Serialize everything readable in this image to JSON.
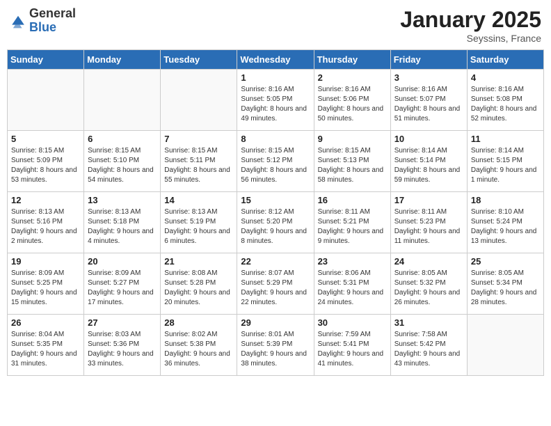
{
  "header": {
    "logo_general": "General",
    "logo_blue": "Blue",
    "month": "January 2025",
    "location": "Seyssins, France"
  },
  "days_of_week": [
    "Sunday",
    "Monday",
    "Tuesday",
    "Wednesday",
    "Thursday",
    "Friday",
    "Saturday"
  ],
  "weeks": [
    [
      {
        "num": "",
        "info": ""
      },
      {
        "num": "",
        "info": ""
      },
      {
        "num": "",
        "info": ""
      },
      {
        "num": "1",
        "info": "Sunrise: 8:16 AM\nSunset: 5:05 PM\nDaylight: 8 hours and 49 minutes."
      },
      {
        "num": "2",
        "info": "Sunrise: 8:16 AM\nSunset: 5:06 PM\nDaylight: 8 hours and 50 minutes."
      },
      {
        "num": "3",
        "info": "Sunrise: 8:16 AM\nSunset: 5:07 PM\nDaylight: 8 hours and 51 minutes."
      },
      {
        "num": "4",
        "info": "Sunrise: 8:16 AM\nSunset: 5:08 PM\nDaylight: 8 hours and 52 minutes."
      }
    ],
    [
      {
        "num": "5",
        "info": "Sunrise: 8:15 AM\nSunset: 5:09 PM\nDaylight: 8 hours and 53 minutes."
      },
      {
        "num": "6",
        "info": "Sunrise: 8:15 AM\nSunset: 5:10 PM\nDaylight: 8 hours and 54 minutes."
      },
      {
        "num": "7",
        "info": "Sunrise: 8:15 AM\nSunset: 5:11 PM\nDaylight: 8 hours and 55 minutes."
      },
      {
        "num": "8",
        "info": "Sunrise: 8:15 AM\nSunset: 5:12 PM\nDaylight: 8 hours and 56 minutes."
      },
      {
        "num": "9",
        "info": "Sunrise: 8:15 AM\nSunset: 5:13 PM\nDaylight: 8 hours and 58 minutes."
      },
      {
        "num": "10",
        "info": "Sunrise: 8:14 AM\nSunset: 5:14 PM\nDaylight: 8 hours and 59 minutes."
      },
      {
        "num": "11",
        "info": "Sunrise: 8:14 AM\nSunset: 5:15 PM\nDaylight: 9 hours and 1 minute."
      }
    ],
    [
      {
        "num": "12",
        "info": "Sunrise: 8:13 AM\nSunset: 5:16 PM\nDaylight: 9 hours and 2 minutes."
      },
      {
        "num": "13",
        "info": "Sunrise: 8:13 AM\nSunset: 5:18 PM\nDaylight: 9 hours and 4 minutes."
      },
      {
        "num": "14",
        "info": "Sunrise: 8:13 AM\nSunset: 5:19 PM\nDaylight: 9 hours and 6 minutes."
      },
      {
        "num": "15",
        "info": "Sunrise: 8:12 AM\nSunset: 5:20 PM\nDaylight: 9 hours and 8 minutes."
      },
      {
        "num": "16",
        "info": "Sunrise: 8:11 AM\nSunset: 5:21 PM\nDaylight: 9 hours and 9 minutes."
      },
      {
        "num": "17",
        "info": "Sunrise: 8:11 AM\nSunset: 5:23 PM\nDaylight: 9 hours and 11 minutes."
      },
      {
        "num": "18",
        "info": "Sunrise: 8:10 AM\nSunset: 5:24 PM\nDaylight: 9 hours and 13 minutes."
      }
    ],
    [
      {
        "num": "19",
        "info": "Sunrise: 8:09 AM\nSunset: 5:25 PM\nDaylight: 9 hours and 15 minutes."
      },
      {
        "num": "20",
        "info": "Sunrise: 8:09 AM\nSunset: 5:27 PM\nDaylight: 9 hours and 17 minutes."
      },
      {
        "num": "21",
        "info": "Sunrise: 8:08 AM\nSunset: 5:28 PM\nDaylight: 9 hours and 20 minutes."
      },
      {
        "num": "22",
        "info": "Sunrise: 8:07 AM\nSunset: 5:29 PM\nDaylight: 9 hours and 22 minutes."
      },
      {
        "num": "23",
        "info": "Sunrise: 8:06 AM\nSunset: 5:31 PM\nDaylight: 9 hours and 24 minutes."
      },
      {
        "num": "24",
        "info": "Sunrise: 8:05 AM\nSunset: 5:32 PM\nDaylight: 9 hours and 26 minutes."
      },
      {
        "num": "25",
        "info": "Sunrise: 8:05 AM\nSunset: 5:34 PM\nDaylight: 9 hours and 28 minutes."
      }
    ],
    [
      {
        "num": "26",
        "info": "Sunrise: 8:04 AM\nSunset: 5:35 PM\nDaylight: 9 hours and 31 minutes."
      },
      {
        "num": "27",
        "info": "Sunrise: 8:03 AM\nSunset: 5:36 PM\nDaylight: 9 hours and 33 minutes."
      },
      {
        "num": "28",
        "info": "Sunrise: 8:02 AM\nSunset: 5:38 PM\nDaylight: 9 hours and 36 minutes."
      },
      {
        "num": "29",
        "info": "Sunrise: 8:01 AM\nSunset: 5:39 PM\nDaylight: 9 hours and 38 minutes."
      },
      {
        "num": "30",
        "info": "Sunrise: 7:59 AM\nSunset: 5:41 PM\nDaylight: 9 hours and 41 minutes."
      },
      {
        "num": "31",
        "info": "Sunrise: 7:58 AM\nSunset: 5:42 PM\nDaylight: 9 hours and 43 minutes."
      },
      {
        "num": "",
        "info": ""
      }
    ]
  ]
}
